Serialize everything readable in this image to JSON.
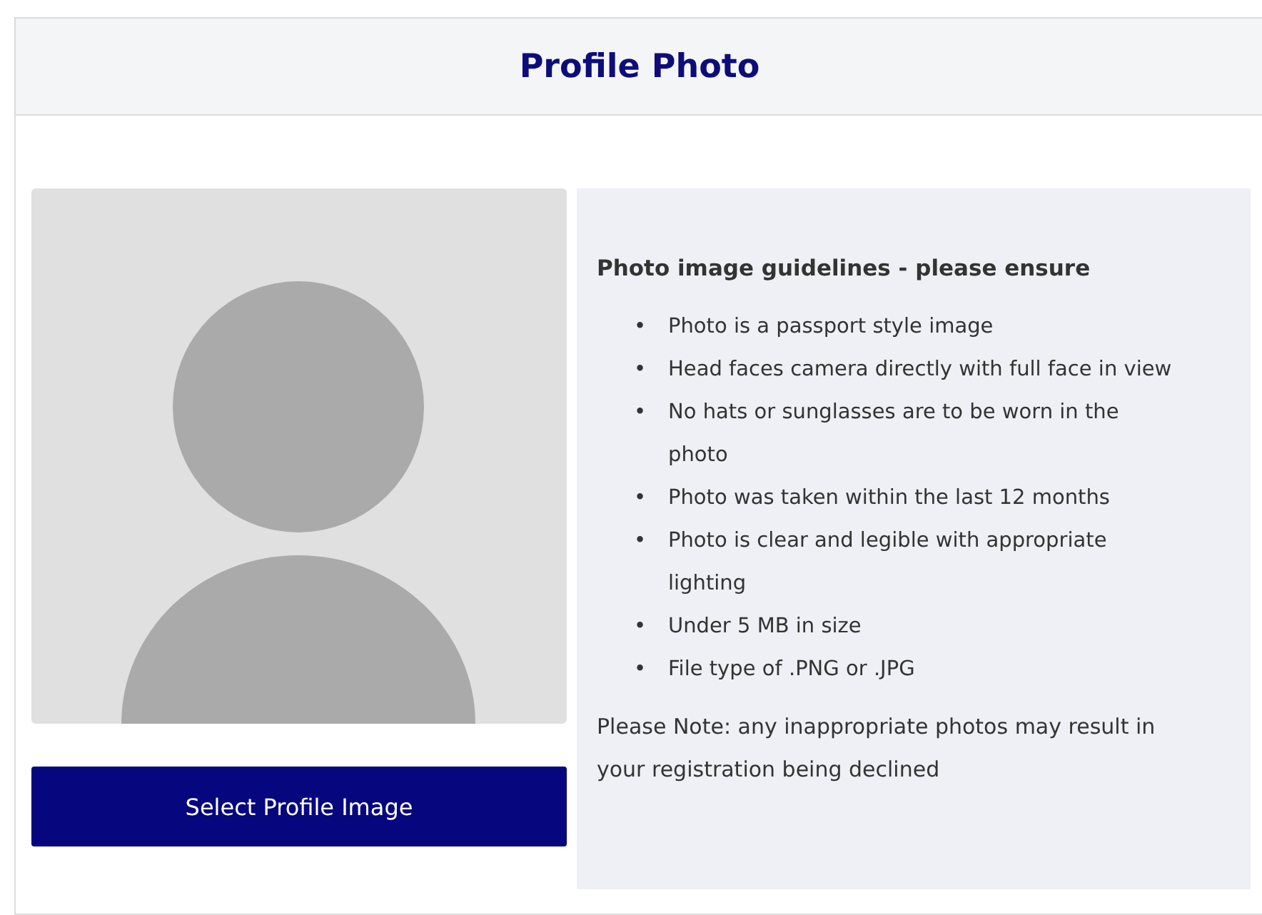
{
  "header": {
    "title": "Profile Photo"
  },
  "photo": {
    "kind": "avatar"
  },
  "select_button": {
    "label": "Select Profile Image"
  },
  "guidelines": {
    "heading": "Photo image guidelines - please ensure",
    "items": [
      {
        "bullet": "•",
        "text": "Photo is a passport style image"
      },
      {
        "bullet": "•",
        "text": "Head faces camera directly with full face in view"
      },
      {
        "bullet": "•",
        "text": "No hats or sunglasses are to be worn in the photo"
      },
      {
        "bullet": "•",
        "text": "Photo was taken within the last 12 months"
      },
      {
        "bullet": "•",
        "text": "Photo is clear and legible with appropriate lighting"
      },
      {
        "bullet": "•",
        "text": "Under 5 MB in size"
      },
      {
        "bullet": "•",
        "text": "File type of .PNG or .JPG"
      }
    ],
    "note": "Please Note: any inappropriate photos may result in your registration being declined"
  }
}
